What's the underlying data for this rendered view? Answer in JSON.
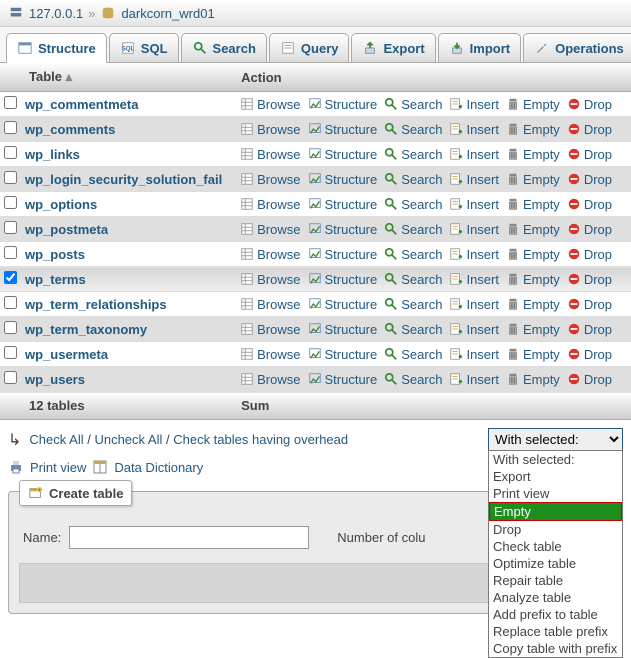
{
  "breadcrumb": {
    "host": "127.0.0.1",
    "db": "darkcorn_wrd01"
  },
  "tabs": [
    {
      "id": "structure",
      "label": "Structure",
      "active": true
    },
    {
      "id": "sql",
      "label": "SQL"
    },
    {
      "id": "search",
      "label": "Search"
    },
    {
      "id": "query",
      "label": "Query"
    },
    {
      "id": "export",
      "label": "Export"
    },
    {
      "id": "import",
      "label": "Import"
    },
    {
      "id": "operations",
      "label": "Operations"
    }
  ],
  "headers": {
    "table": "Table",
    "action": "Action"
  },
  "actions": {
    "browse": "Browse",
    "structure": "Structure",
    "search": "Search",
    "insert": "Insert",
    "empty": "Empty",
    "drop": "Drop"
  },
  "tables": [
    {
      "name": "wp_commentmeta",
      "checked": false
    },
    {
      "name": "wp_comments",
      "checked": false
    },
    {
      "name": "wp_links",
      "checked": false
    },
    {
      "name": "wp_login_security_solution_fail",
      "checked": false
    },
    {
      "name": "wp_options",
      "checked": false
    },
    {
      "name": "wp_postmeta",
      "checked": false
    },
    {
      "name": "wp_posts",
      "checked": false
    },
    {
      "name": "wp_terms",
      "checked": true
    },
    {
      "name": "wp_term_relationships",
      "checked": false
    },
    {
      "name": "wp_term_taxonomy",
      "checked": false
    },
    {
      "name": "wp_usermeta",
      "checked": false
    },
    {
      "name": "wp_users",
      "checked": false
    }
  ],
  "footer": {
    "count": "12 tables",
    "sum": "Sum"
  },
  "checkbar": {
    "check_all": "Check All",
    "uncheck_all": "Uncheck All",
    "overhead": "Check tables having overhead",
    "sep": " / "
  },
  "withSelected": {
    "label": "With selected:",
    "options": [
      "With selected:",
      "Export",
      "Print view",
      "Empty",
      "Drop",
      "Check table",
      "Optimize table",
      "Repair table",
      "Analyze table",
      "Add prefix to table",
      "Replace table prefix",
      "Copy table with prefix"
    ],
    "highlighted": "Empty"
  },
  "utils": {
    "print_view": "Print view",
    "data_dict": "Data Dictionary"
  },
  "createTable": {
    "legend": "Create table",
    "name_label": "Name:",
    "cols_label": "Number of colu"
  }
}
